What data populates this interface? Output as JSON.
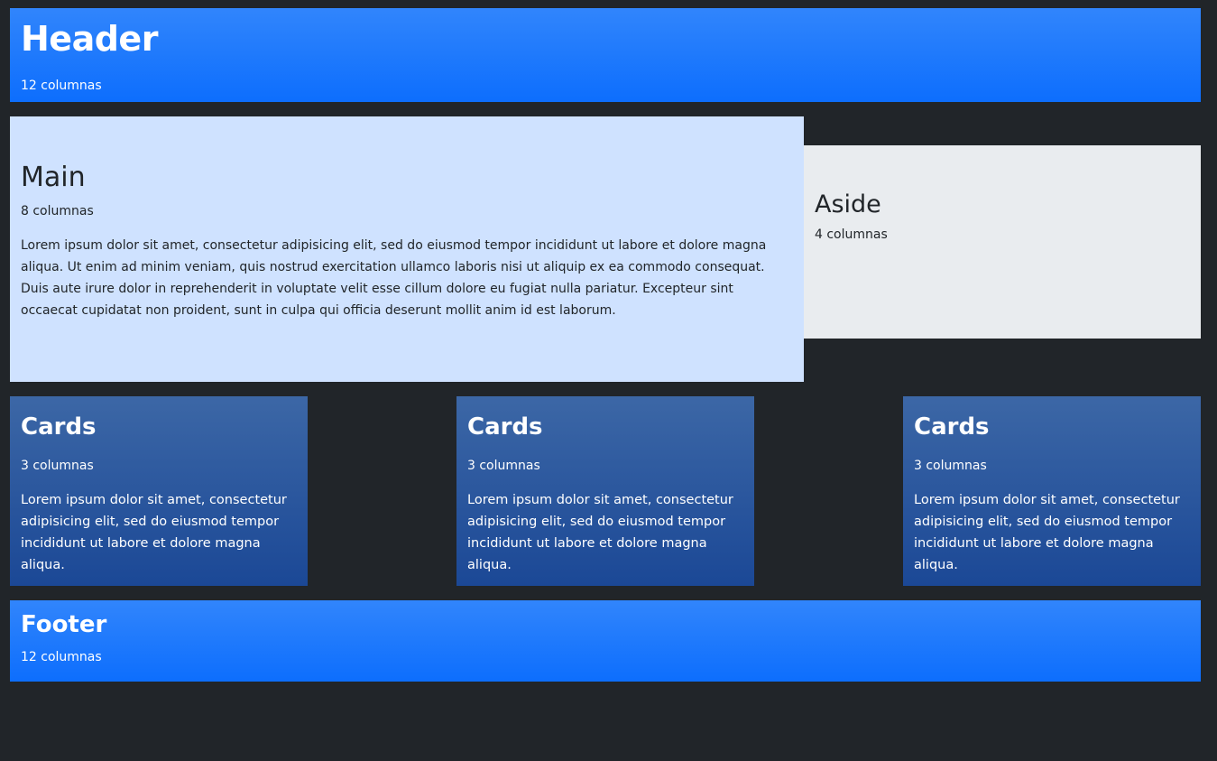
{
  "header": {
    "title": "Header",
    "subtitle": "12 columnas"
  },
  "main": {
    "title": "Main",
    "subtitle": "8 columnas",
    "body": "Lorem ipsum dolor sit amet, consectetur adipisicing elit, sed do eiusmod tempor incididunt ut labore et dolore magna aliqua. Ut enim ad minim veniam, quis nostrud exercitation ullamco laboris nisi ut aliquip ex ea commodo consequat. Duis aute irure dolor in reprehenderit in voluptate velit esse cillum dolore eu fugiat nulla pariatur. Excepteur sint occaecat cupidatat non proident, sunt in culpa qui officia deserunt mollit anim id est laborum."
  },
  "aside": {
    "title": "Aside",
    "subtitle": "4 columnas"
  },
  "cards": [
    {
      "title": "Cards",
      "subtitle": "3 columnas",
      "body": "Lorem ipsum dolor sit amet, consectetur adipisicing elit, sed do eiusmod tempor incididunt ut labore et dolore magna aliqua."
    },
    {
      "title": "Cards",
      "subtitle": "3 columnas",
      "body": "Lorem ipsum dolor sit amet, consectetur adipisicing elit, sed do eiusmod tempor incididunt ut labore et dolore magna aliqua."
    },
    {
      "title": "Cards",
      "subtitle": "3 columnas",
      "body": "Lorem ipsum dolor sit amet, consectetur adipisicing elit, sed do eiusmod tempor incididunt ut labore et dolore magna aliqua."
    }
  ],
  "footer": {
    "title": "Footer",
    "subtitle": "12 columnas"
  },
  "colors": {
    "page_background": "#212529",
    "header_footer_blue": "#0d6efd",
    "main_background": "#cfe2ff",
    "aside_background": "#e9ecef",
    "card_background": "#1b4896",
    "dark_text": "#212529",
    "light_text": "#ffffff"
  }
}
